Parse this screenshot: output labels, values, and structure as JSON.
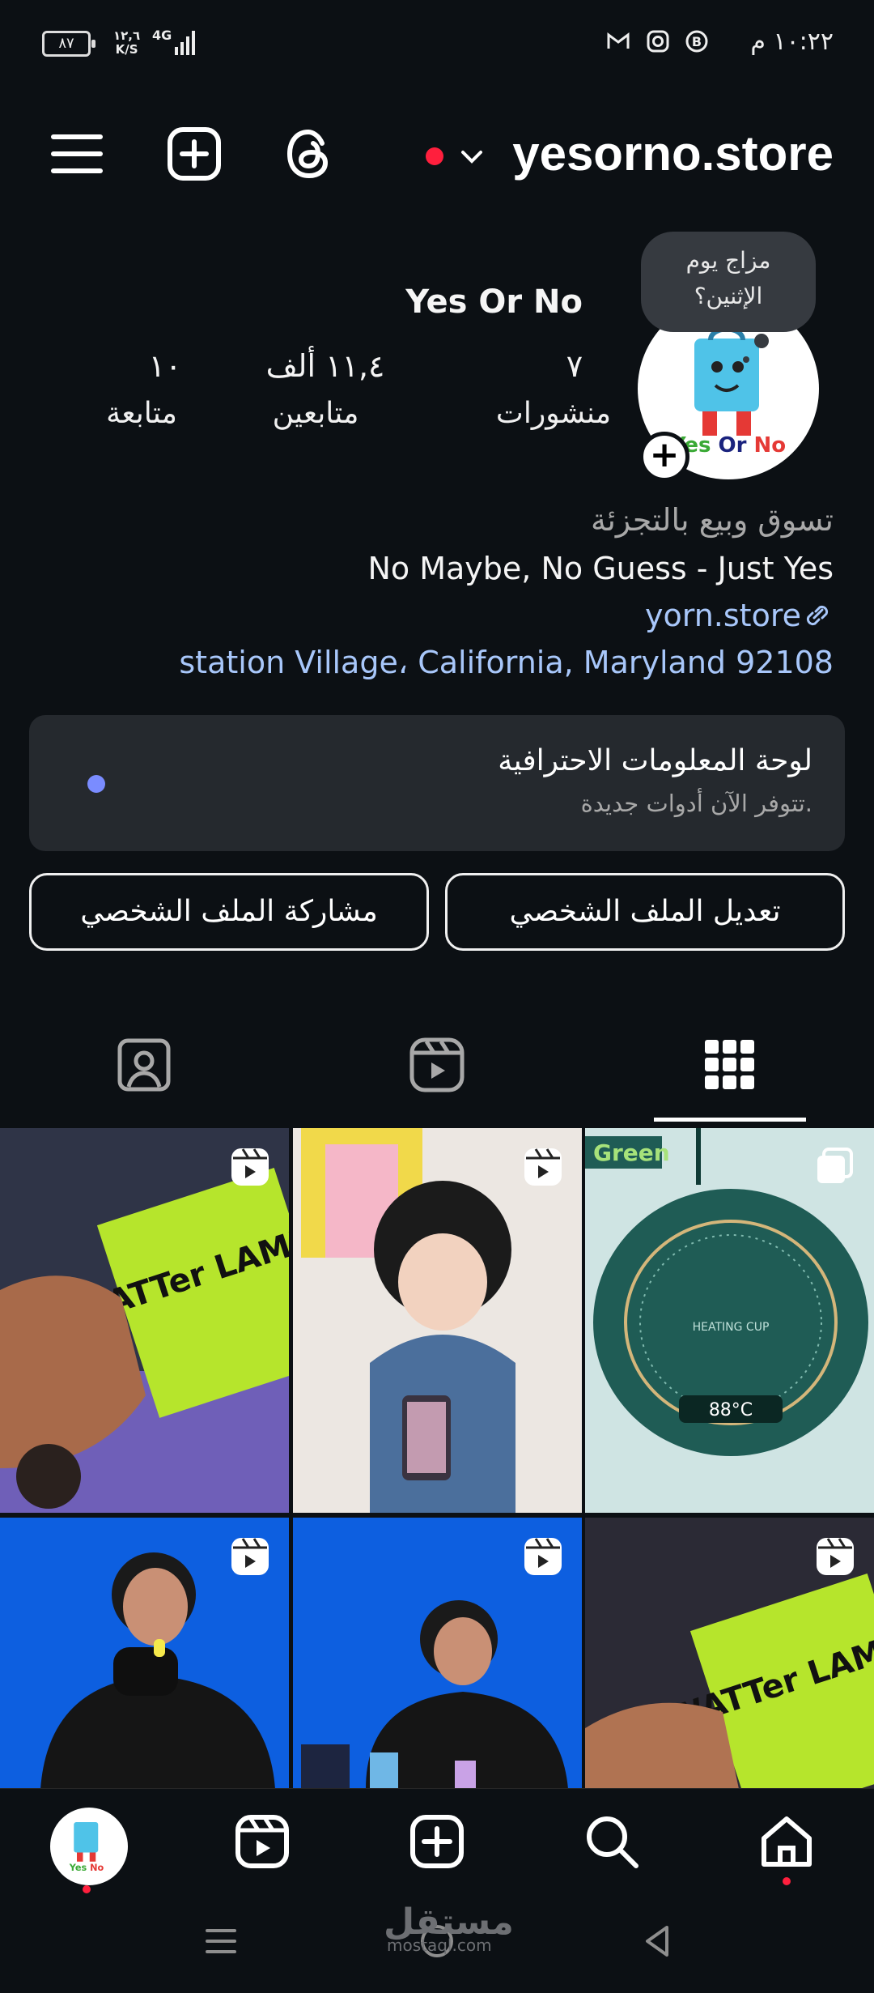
{
  "status_bar": {
    "time": "١٠:٢٢ م",
    "battery": "٨٧",
    "net_speed_value": "١٢,٦",
    "net_speed_unit": "K/S",
    "network_type": "4G",
    "icons": [
      "gmail-icon",
      "instagram-icon",
      "b-icon"
    ]
  },
  "header": {
    "username": "yesorno.store",
    "icons": [
      "menu-icon",
      "add-post-icon",
      "threads-icon",
      "chevron-down-icon"
    ]
  },
  "profile": {
    "note_text_line1": "مزاج يوم",
    "note_text_line2": "الإثنين؟",
    "display_name": "Yes Or No",
    "avatar_logo_text": "Yes Or No",
    "stats": [
      {
        "value": "٧",
        "label": "منشورات"
      },
      {
        "value": "١١,٤ ألف",
        "label": "متابعين"
      },
      {
        "value": "١٠",
        "label": "متابعة"
      }
    ],
    "bio_category": "تسوق وبيع بالتجزئة",
    "bio_text": "No Maybe, No Guess - Just Yes",
    "bio_link": "yorn.store",
    "bio_address": "station Village، California, Maryland 92108"
  },
  "dashboard": {
    "title": "لوحة المعلومات الاحترافية",
    "subtitle": "تتوفر الآن أدوات جديدة."
  },
  "actions": {
    "edit_profile": "تعديل الملف الشخصي",
    "share_profile": "مشاركة الملف الشخصي"
  },
  "tabs": [
    "grid-icon",
    "reels-icon",
    "tagged-icon"
  ],
  "grid": {
    "posts": [
      {
        "type": "carousel",
        "overlay_text": "Green",
        "display_text": "88°C",
        "product_text": "HEATING CUP",
        "colors": [
          "#cfe4e3",
          "#1f5c55"
        ]
      },
      {
        "type": "reel",
        "colors": [
          "#e8e0da",
          "#3b5f8a"
        ]
      },
      {
        "type": "reel",
        "product_text": "WATTer LAMP",
        "colors": [
          "#3a3f52",
          "#b6e52c"
        ]
      },
      {
        "type": "reel",
        "product_text": "WATTer LAMP",
        "colors": [
          "#2b2a35",
          "#b6e52c"
        ]
      },
      {
        "type": "reel",
        "colors": [
          "#0d5fe0",
          "#111111"
        ]
      },
      {
        "type": "reel",
        "colors": [
          "#0d5fe0",
          "#111111"
        ]
      }
    ]
  },
  "bottom_nav": [
    "home-icon",
    "search-icon",
    "create-icon",
    "reels-icon",
    "profile-avatar"
  ],
  "watermark": {
    "main": "مستقل",
    "sub": "mostaql.com"
  },
  "colors": {
    "background": "#0c1014",
    "link": "#a8c7fa",
    "notification": "#ff1f3d",
    "card": "#25292e"
  }
}
